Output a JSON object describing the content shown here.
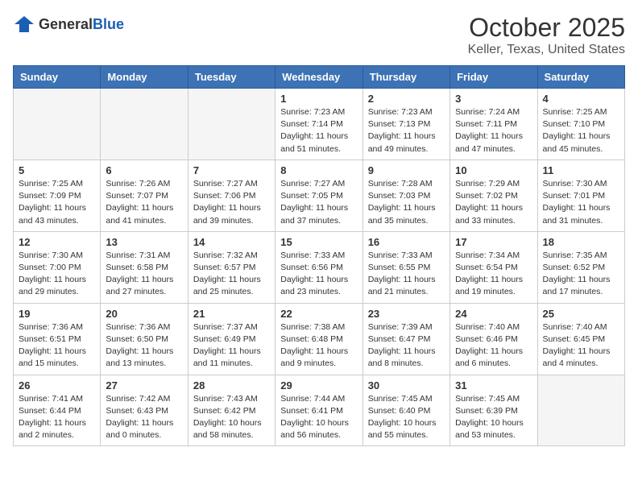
{
  "logo": {
    "general": "General",
    "blue": "Blue"
  },
  "header": {
    "title": "October 2025",
    "subtitle": "Keller, Texas, United States"
  },
  "weekdays": [
    "Sunday",
    "Monday",
    "Tuesday",
    "Wednesday",
    "Thursday",
    "Friday",
    "Saturday"
  ],
  "weeks": [
    [
      {
        "day": "",
        "info": ""
      },
      {
        "day": "",
        "info": ""
      },
      {
        "day": "",
        "info": ""
      },
      {
        "day": "1",
        "info": "Sunrise: 7:23 AM\nSunset: 7:14 PM\nDaylight: 11 hours\nand 51 minutes."
      },
      {
        "day": "2",
        "info": "Sunrise: 7:23 AM\nSunset: 7:13 PM\nDaylight: 11 hours\nand 49 minutes."
      },
      {
        "day": "3",
        "info": "Sunrise: 7:24 AM\nSunset: 7:11 PM\nDaylight: 11 hours\nand 47 minutes."
      },
      {
        "day": "4",
        "info": "Sunrise: 7:25 AM\nSunset: 7:10 PM\nDaylight: 11 hours\nand 45 minutes."
      }
    ],
    [
      {
        "day": "5",
        "info": "Sunrise: 7:25 AM\nSunset: 7:09 PM\nDaylight: 11 hours\nand 43 minutes."
      },
      {
        "day": "6",
        "info": "Sunrise: 7:26 AM\nSunset: 7:07 PM\nDaylight: 11 hours\nand 41 minutes."
      },
      {
        "day": "7",
        "info": "Sunrise: 7:27 AM\nSunset: 7:06 PM\nDaylight: 11 hours\nand 39 minutes."
      },
      {
        "day": "8",
        "info": "Sunrise: 7:27 AM\nSunset: 7:05 PM\nDaylight: 11 hours\nand 37 minutes."
      },
      {
        "day": "9",
        "info": "Sunrise: 7:28 AM\nSunset: 7:03 PM\nDaylight: 11 hours\nand 35 minutes."
      },
      {
        "day": "10",
        "info": "Sunrise: 7:29 AM\nSunset: 7:02 PM\nDaylight: 11 hours\nand 33 minutes."
      },
      {
        "day": "11",
        "info": "Sunrise: 7:30 AM\nSunset: 7:01 PM\nDaylight: 11 hours\nand 31 minutes."
      }
    ],
    [
      {
        "day": "12",
        "info": "Sunrise: 7:30 AM\nSunset: 7:00 PM\nDaylight: 11 hours\nand 29 minutes."
      },
      {
        "day": "13",
        "info": "Sunrise: 7:31 AM\nSunset: 6:58 PM\nDaylight: 11 hours\nand 27 minutes."
      },
      {
        "day": "14",
        "info": "Sunrise: 7:32 AM\nSunset: 6:57 PM\nDaylight: 11 hours\nand 25 minutes."
      },
      {
        "day": "15",
        "info": "Sunrise: 7:33 AM\nSunset: 6:56 PM\nDaylight: 11 hours\nand 23 minutes."
      },
      {
        "day": "16",
        "info": "Sunrise: 7:33 AM\nSunset: 6:55 PM\nDaylight: 11 hours\nand 21 minutes."
      },
      {
        "day": "17",
        "info": "Sunrise: 7:34 AM\nSunset: 6:54 PM\nDaylight: 11 hours\nand 19 minutes."
      },
      {
        "day": "18",
        "info": "Sunrise: 7:35 AM\nSunset: 6:52 PM\nDaylight: 11 hours\nand 17 minutes."
      }
    ],
    [
      {
        "day": "19",
        "info": "Sunrise: 7:36 AM\nSunset: 6:51 PM\nDaylight: 11 hours\nand 15 minutes."
      },
      {
        "day": "20",
        "info": "Sunrise: 7:36 AM\nSunset: 6:50 PM\nDaylight: 11 hours\nand 13 minutes."
      },
      {
        "day": "21",
        "info": "Sunrise: 7:37 AM\nSunset: 6:49 PM\nDaylight: 11 hours\nand 11 minutes."
      },
      {
        "day": "22",
        "info": "Sunrise: 7:38 AM\nSunset: 6:48 PM\nDaylight: 11 hours\nand 9 minutes."
      },
      {
        "day": "23",
        "info": "Sunrise: 7:39 AM\nSunset: 6:47 PM\nDaylight: 11 hours\nand 8 minutes."
      },
      {
        "day": "24",
        "info": "Sunrise: 7:40 AM\nSunset: 6:46 PM\nDaylight: 11 hours\nand 6 minutes."
      },
      {
        "day": "25",
        "info": "Sunrise: 7:40 AM\nSunset: 6:45 PM\nDaylight: 11 hours\nand 4 minutes."
      }
    ],
    [
      {
        "day": "26",
        "info": "Sunrise: 7:41 AM\nSunset: 6:44 PM\nDaylight: 11 hours\nand 2 minutes."
      },
      {
        "day": "27",
        "info": "Sunrise: 7:42 AM\nSunset: 6:43 PM\nDaylight: 11 hours\nand 0 minutes."
      },
      {
        "day": "28",
        "info": "Sunrise: 7:43 AM\nSunset: 6:42 PM\nDaylight: 10 hours\nand 58 minutes."
      },
      {
        "day": "29",
        "info": "Sunrise: 7:44 AM\nSunset: 6:41 PM\nDaylight: 10 hours\nand 56 minutes."
      },
      {
        "day": "30",
        "info": "Sunrise: 7:45 AM\nSunset: 6:40 PM\nDaylight: 10 hours\nand 55 minutes."
      },
      {
        "day": "31",
        "info": "Sunrise: 7:45 AM\nSunset: 6:39 PM\nDaylight: 10 hours\nand 53 minutes."
      },
      {
        "day": "",
        "info": ""
      }
    ]
  ]
}
